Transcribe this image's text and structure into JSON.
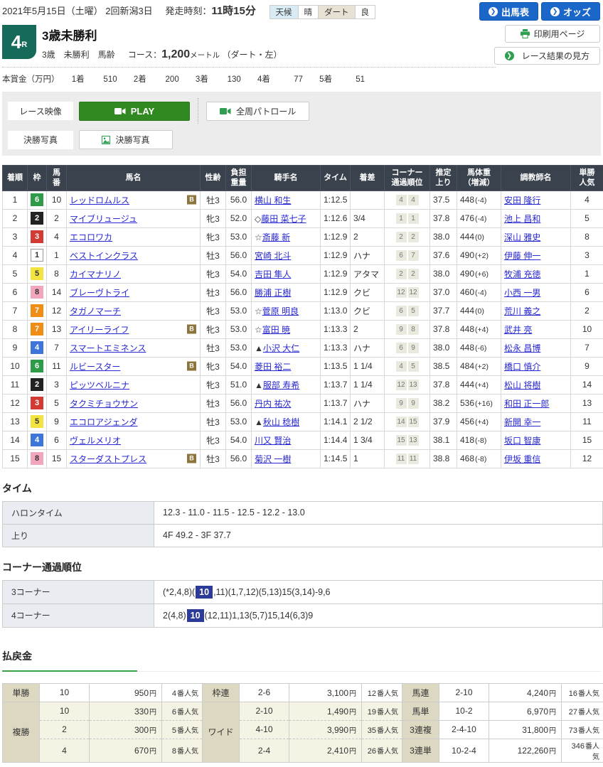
{
  "header": {
    "date_line": "2021年5月15日（土曜）  2回新潟3日",
    "start_label": "発走時刻：",
    "start_time": "11時15分",
    "weather_label": "天候",
    "weather_value": "晴",
    "track_label": "ダート",
    "track_value": "良",
    "btn_shutsuba": "出馬表",
    "btn_odds": "オッズ",
    "btn_print": "印刷用ページ",
    "btn_guide": "レース結果の見方"
  },
  "race": {
    "number": "4",
    "number_suffix": "R",
    "title": "3歳未勝利",
    "conditions": "3歳　未勝利　馬齢",
    "course_label": "コース：",
    "course_value": "1,200",
    "course_unit": "メートル",
    "course_note": "（ダート・左）"
  },
  "prize": {
    "label": "本賞金（万円）",
    "items": [
      {
        "place": "1着",
        "amount": "510"
      },
      {
        "place": "2着",
        "amount": "200"
      },
      {
        "place": "3着",
        "amount": "130"
      },
      {
        "place": "4着",
        "amount": "77"
      },
      {
        "place": "5着",
        "amount": "51"
      }
    ]
  },
  "media": {
    "race_video_label": "レース映像",
    "play_label": "PLAY",
    "patrol_label": "全周パトロール",
    "photo_label": "決勝写真",
    "photo_button_label": "決勝写真"
  },
  "results": {
    "blinker_label": "B",
    "headers": [
      "着順",
      "枠",
      "馬\n番",
      "馬名",
      "性齢",
      "負担\n重量",
      "騎手名",
      "タイム",
      "着差",
      "コーナー\n通過順位",
      "推定\n上り",
      "馬体重\n（増減）",
      "調教師名",
      "単勝\n人気"
    ],
    "rows": [
      {
        "place": "1",
        "frame": "6",
        "number": "10",
        "name": "レッドロムルス",
        "blinker": true,
        "sex_age": "牡3",
        "weight": "56.0",
        "jockey_mark": "",
        "jockey": "横山 和生",
        "time": "1:12.5",
        "margin": "",
        "corners": [
          "4",
          "4"
        ],
        "last3f": "37.5",
        "body_weight": "448",
        "body_weight_diff": "(-4)",
        "trainer": "安田 隆行",
        "popularity": "4"
      },
      {
        "place": "2",
        "frame": "2",
        "number": "2",
        "name": "マイブリュージュ",
        "blinker": false,
        "sex_age": "牝3",
        "weight": "52.0",
        "jockey_mark": "◇",
        "jockey": "藤田 菜七子",
        "time": "1:12.6",
        "margin": "3/4",
        "corners": [
          "1",
          "1"
        ],
        "last3f": "37.8",
        "body_weight": "476",
        "body_weight_diff": "(-4)",
        "trainer": "池上 昌和",
        "popularity": "5"
      },
      {
        "place": "3",
        "frame": "3",
        "number": "4",
        "name": "エコロワカ",
        "blinker": false,
        "sex_age": "牝3",
        "weight": "53.0",
        "jockey_mark": "☆",
        "jockey": "斎藤 新",
        "time": "1:12.9",
        "margin": "2",
        "corners": [
          "2",
          "2"
        ],
        "last3f": "38.0",
        "body_weight": "444",
        "body_weight_diff": "(0)",
        "trainer": "深山 雅史",
        "popularity": "8"
      },
      {
        "place": "4",
        "frame": "1",
        "number": "1",
        "name": "ベストインクラス",
        "blinker": false,
        "sex_age": "牡3",
        "weight": "56.0",
        "jockey_mark": "",
        "jockey": "宮崎 北斗",
        "time": "1:12.9",
        "margin": "ハナ",
        "corners": [
          "6",
          "7"
        ],
        "last3f": "37.6",
        "body_weight": "490",
        "body_weight_diff": "(+2)",
        "trainer": "伊藤 伸一",
        "popularity": "3"
      },
      {
        "place": "5",
        "frame": "5",
        "number": "8",
        "name": "カイマナリノ",
        "blinker": false,
        "sex_age": "牝3",
        "weight": "54.0",
        "jockey_mark": "",
        "jockey": "吉田 隼人",
        "time": "1:12.9",
        "margin": "アタマ",
        "corners": [
          "2",
          "2"
        ],
        "last3f": "38.0",
        "body_weight": "490",
        "body_weight_diff": "(+6)",
        "trainer": "牧浦 充徳",
        "popularity": "1"
      },
      {
        "place": "6",
        "frame": "8",
        "number": "14",
        "name": "ブレーヴトライ",
        "blinker": false,
        "sex_age": "牡3",
        "weight": "56.0",
        "jockey_mark": "",
        "jockey": "勝浦 正樹",
        "time": "1:12.9",
        "margin": "クビ",
        "corners": [
          "12",
          "12"
        ],
        "last3f": "37.0",
        "body_weight": "460",
        "body_weight_diff": "(-4)",
        "trainer": "小西 一男",
        "popularity": "6"
      },
      {
        "place": "7",
        "frame": "7",
        "number": "12",
        "name": "タガノマーチ",
        "blinker": false,
        "sex_age": "牝3",
        "weight": "53.0",
        "jockey_mark": "☆",
        "jockey": "菅原 明良",
        "time": "1:13.0",
        "margin": "クビ",
        "corners": [
          "6",
          "5"
        ],
        "last3f": "37.7",
        "body_weight": "444",
        "body_weight_diff": "(0)",
        "trainer": "荒川 義之",
        "popularity": "2"
      },
      {
        "place": "8",
        "frame": "7",
        "number": "13",
        "name": "アイリーライフ",
        "blinker": true,
        "sex_age": "牝3",
        "weight": "53.0",
        "jockey_mark": "☆",
        "jockey": "富田 暁",
        "time": "1:13.3",
        "margin": "2",
        "corners": [
          "9",
          "8"
        ],
        "last3f": "37.8",
        "body_weight": "448",
        "body_weight_diff": "(+4)",
        "trainer": "武井 亮",
        "popularity": "10"
      },
      {
        "place": "9",
        "frame": "4",
        "number": "7",
        "name": "スマートエミネンス",
        "blinker": false,
        "sex_age": "牡3",
        "weight": "53.0",
        "jockey_mark": "▲",
        "jockey": "小沢 大仁",
        "time": "1:13.3",
        "margin": "ハナ",
        "corners": [
          "6",
          "9"
        ],
        "last3f": "38.0",
        "body_weight": "448",
        "body_weight_diff": "(-6)",
        "trainer": "松永 昌博",
        "popularity": "7"
      },
      {
        "place": "10",
        "frame": "6",
        "number": "11",
        "name": "ルビースター",
        "blinker": true,
        "sex_age": "牝3",
        "weight": "54.0",
        "jockey_mark": "",
        "jockey": "菱田 裕二",
        "time": "1:13.5",
        "margin": "1 1/4",
        "corners": [
          "4",
          "5"
        ],
        "last3f": "38.5",
        "body_weight": "484",
        "body_weight_diff": "(+2)",
        "trainer": "橋口 慎介",
        "popularity": "9"
      },
      {
        "place": "11",
        "frame": "2",
        "number": "3",
        "name": "ピッツベルニナ",
        "blinker": false,
        "sex_age": "牝3",
        "weight": "51.0",
        "jockey_mark": "▲",
        "jockey": "服部 寿希",
        "time": "1:13.7",
        "margin": "1 1/4",
        "corners": [
          "12",
          "13"
        ],
        "last3f": "37.8",
        "body_weight": "444",
        "body_weight_diff": "(+4)",
        "trainer": "松山 将樹",
        "popularity": "14"
      },
      {
        "place": "12",
        "frame": "3",
        "number": "5",
        "name": "タクミチョウサン",
        "blinker": false,
        "sex_age": "牡3",
        "weight": "56.0",
        "jockey_mark": "",
        "jockey": "丹内 祐次",
        "time": "1:13.7",
        "margin": "ハナ",
        "corners": [
          "9",
          "9"
        ],
        "last3f": "38.2",
        "body_weight": "536",
        "body_weight_diff": "(+16)",
        "trainer": "和田 正一郎",
        "popularity": "13"
      },
      {
        "place": "13",
        "frame": "5",
        "number": "9",
        "name": "エコロアジェンダ",
        "blinker": false,
        "sex_age": "牡3",
        "weight": "53.0",
        "jockey_mark": "▲",
        "jockey": "秋山 稔樹",
        "time": "1:14.1",
        "margin": "2 1/2",
        "corners": [
          "14",
          "15"
        ],
        "last3f": "37.9",
        "body_weight": "456",
        "body_weight_diff": "(+4)",
        "trainer": "新開 幸一",
        "popularity": "11"
      },
      {
        "place": "14",
        "frame": "4",
        "number": "6",
        "name": "ヴェルメリオ",
        "blinker": false,
        "sex_age": "牝3",
        "weight": "54.0",
        "jockey_mark": "",
        "jockey": "川又 賢治",
        "time": "1:14.4",
        "margin": "1 3/4",
        "corners": [
          "15",
          "13"
        ],
        "last3f": "38.1",
        "body_weight": "418",
        "body_weight_diff": "(-8)",
        "trainer": "坂口 智康",
        "popularity": "15"
      },
      {
        "place": "15",
        "frame": "8",
        "number": "15",
        "name": "スターダストプレス",
        "blinker": true,
        "sex_age": "牡3",
        "weight": "56.0",
        "jockey_mark": "",
        "jockey": "菊沢 一樹",
        "time": "1:14.5",
        "margin": "1",
        "corners": [
          "11",
          "11"
        ],
        "last3f": "38.8",
        "body_weight": "468",
        "body_weight_diff": "(-8)",
        "trainer": "伊坂 重信",
        "popularity": "12"
      }
    ]
  },
  "time_section": {
    "title": "タイム",
    "rows": [
      {
        "label": "ハロンタイム",
        "value": "12.3 - 11.0 - 11.5 - 12.5 - 12.2 - 13.0"
      },
      {
        "label": "上り",
        "value": "4F 49.2 - 3F 37.7"
      }
    ]
  },
  "corner_section": {
    "title": "コーナー通過順位",
    "rows": [
      {
        "label": "3コーナー",
        "prefix": "(*2,4,8)(",
        "highlight": "10",
        "suffix": ",11)(1,7,12)(5,13)15(3,14)-9,6"
      },
      {
        "label": "4コーナー",
        "prefix": "2(4,8)",
        "highlight": "10",
        "suffix": "(12,11)1,13(5,7)15,14(6,3)9"
      }
    ]
  },
  "payout": {
    "title": "払戻金",
    "labels": {
      "yen": "円",
      "ninki": "番人気"
    },
    "groups": [
      {
        "bets": [
          {
            "name": "単勝",
            "rows": [
              [
                "10",
                "950",
                "4"
              ]
            ]
          },
          {
            "name": "複勝",
            "rows": [
              [
                "10",
                "330",
                "6"
              ],
              [
                "2",
                "300",
                "5"
              ],
              [
                "4",
                "670",
                "8"
              ]
            ]
          }
        ]
      },
      {
        "bets": [
          {
            "name": "枠連",
            "rows": [
              [
                "2-6",
                "3,100",
                "12"
              ]
            ]
          },
          {
            "name": "ワイド",
            "rows": [
              [
                "2-10",
                "1,490",
                "19"
              ],
              [
                "4-10",
                "3,990",
                "35"
              ],
              [
                "2-4",
                "2,410",
                "26"
              ]
            ]
          }
        ]
      },
      {
        "bets": [
          {
            "name": "馬連",
            "rows": [
              [
                "2-10",
                "4,240",
                "16"
              ]
            ]
          },
          {
            "name": "馬単",
            "rows": [
              [
                "10-2",
                "6,970",
                "27"
              ]
            ]
          },
          {
            "name": "3連複",
            "rows": [
              [
                "2-4-10",
                "31,800",
                "73"
              ]
            ]
          },
          {
            "name": "3連単",
            "rows": [
              [
                "10-2-4",
                "122,260",
                "346"
              ]
            ]
          }
        ]
      }
    ]
  }
}
